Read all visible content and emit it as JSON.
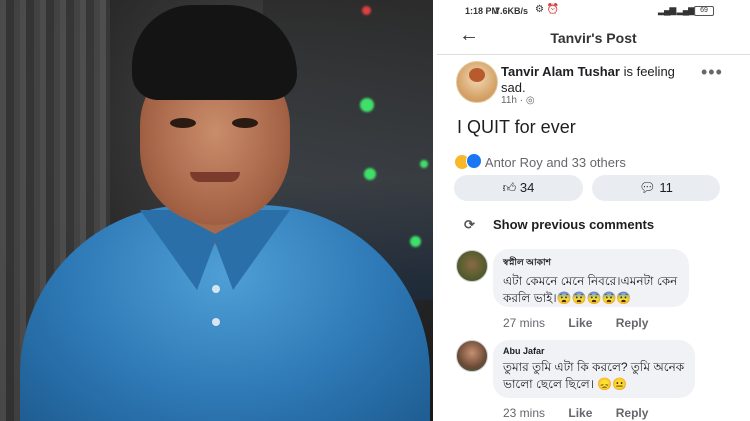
{
  "status_bar": {
    "time": "1:18 PM",
    "speed": "7.6KB/s",
    "battery": "69"
  },
  "header": {
    "back_icon": "arrow-left-icon",
    "title": "Tanvir's Post"
  },
  "post": {
    "author": "Tanvir Alam Tushar",
    "feeling": "is feeling sad.",
    "time": "11h",
    "privacy_icon": "globe-icon",
    "text": "I QUIT for ever",
    "reactions_text": "Antor Roy and 33 others",
    "like_count": "34",
    "comment_count": "11"
  },
  "comments_section": {
    "show_previous": "Show previous comments",
    "comments": [
      {
        "name": "স্বপ্নীল আকাশ",
        "line1": "এটা কেমনে মেনে নিবরে।এমনটা কেন",
        "line2": "করলি ভাই।😨😨😨😨😨",
        "time": "27 mins",
        "like": "Like",
        "reply": "Reply"
      },
      {
        "name": "Abu Jafar",
        "line1": "তুমার তুমি এটা কি করলে?  তুমি অনেক",
        "line2": "ভালো ছেলে ছিলে। 😞😐",
        "time": "23 mins",
        "like": "Like",
        "reply": "Reply"
      }
    ]
  },
  "colors": {
    "reaction_sad": "#f7b928",
    "reaction_like": "#1877f2",
    "pill_bg": "#e9edf2"
  }
}
